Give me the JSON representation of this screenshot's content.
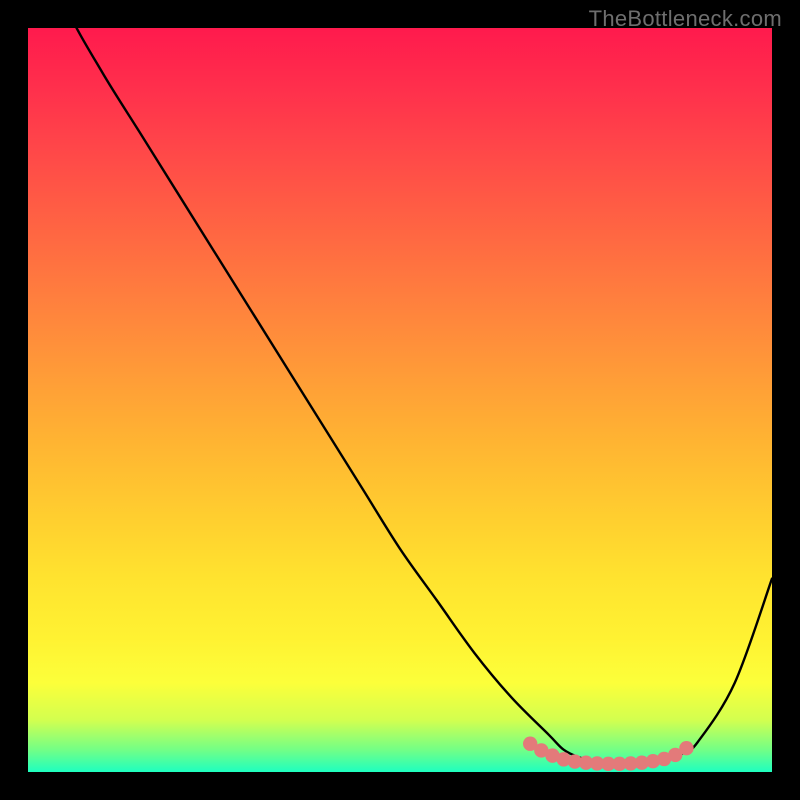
{
  "watermark": "TheBottleneck.com",
  "colors": {
    "background": "#000000",
    "curve_stroke": "#000000",
    "marker_fill": "#e37a7a",
    "watermark_text": "#6e6e6e"
  },
  "chart_data": {
    "type": "line",
    "title": "",
    "xlabel": "",
    "ylabel": "",
    "xlim": [
      0,
      100
    ],
    "ylim": [
      0,
      100
    ],
    "grid": false,
    "series": [
      {
        "name": "curve",
        "x": [
          0,
          5,
          10,
          15,
          20,
          25,
          30,
          35,
          40,
          45,
          50,
          55,
          60,
          65,
          70,
          72,
          74,
          76,
          78,
          80,
          82,
          84,
          86,
          88,
          90,
          95,
          100
        ],
        "y": [
          115,
          103,
          94,
          86,
          78,
          70,
          62,
          54,
          46,
          38,
          30,
          23,
          16,
          10,
          5,
          3,
          2,
          1.5,
          1.2,
          1.1,
          1.1,
          1.3,
          1.7,
          2.5,
          4,
          12,
          26
        ]
      }
    ],
    "markers": {
      "name": "bottom-cluster",
      "region_x": [
        67,
        89
      ],
      "x": [
        67.5,
        69,
        70.5,
        72,
        73.5,
        75,
        76.5,
        78,
        79.5,
        81,
        82.5,
        84,
        85.5,
        87,
        88.5
      ],
      "y": [
        3.8,
        2.9,
        2.2,
        1.7,
        1.4,
        1.25,
        1.15,
        1.1,
        1.1,
        1.15,
        1.25,
        1.45,
        1.75,
        2.3,
        3.2
      ]
    }
  }
}
